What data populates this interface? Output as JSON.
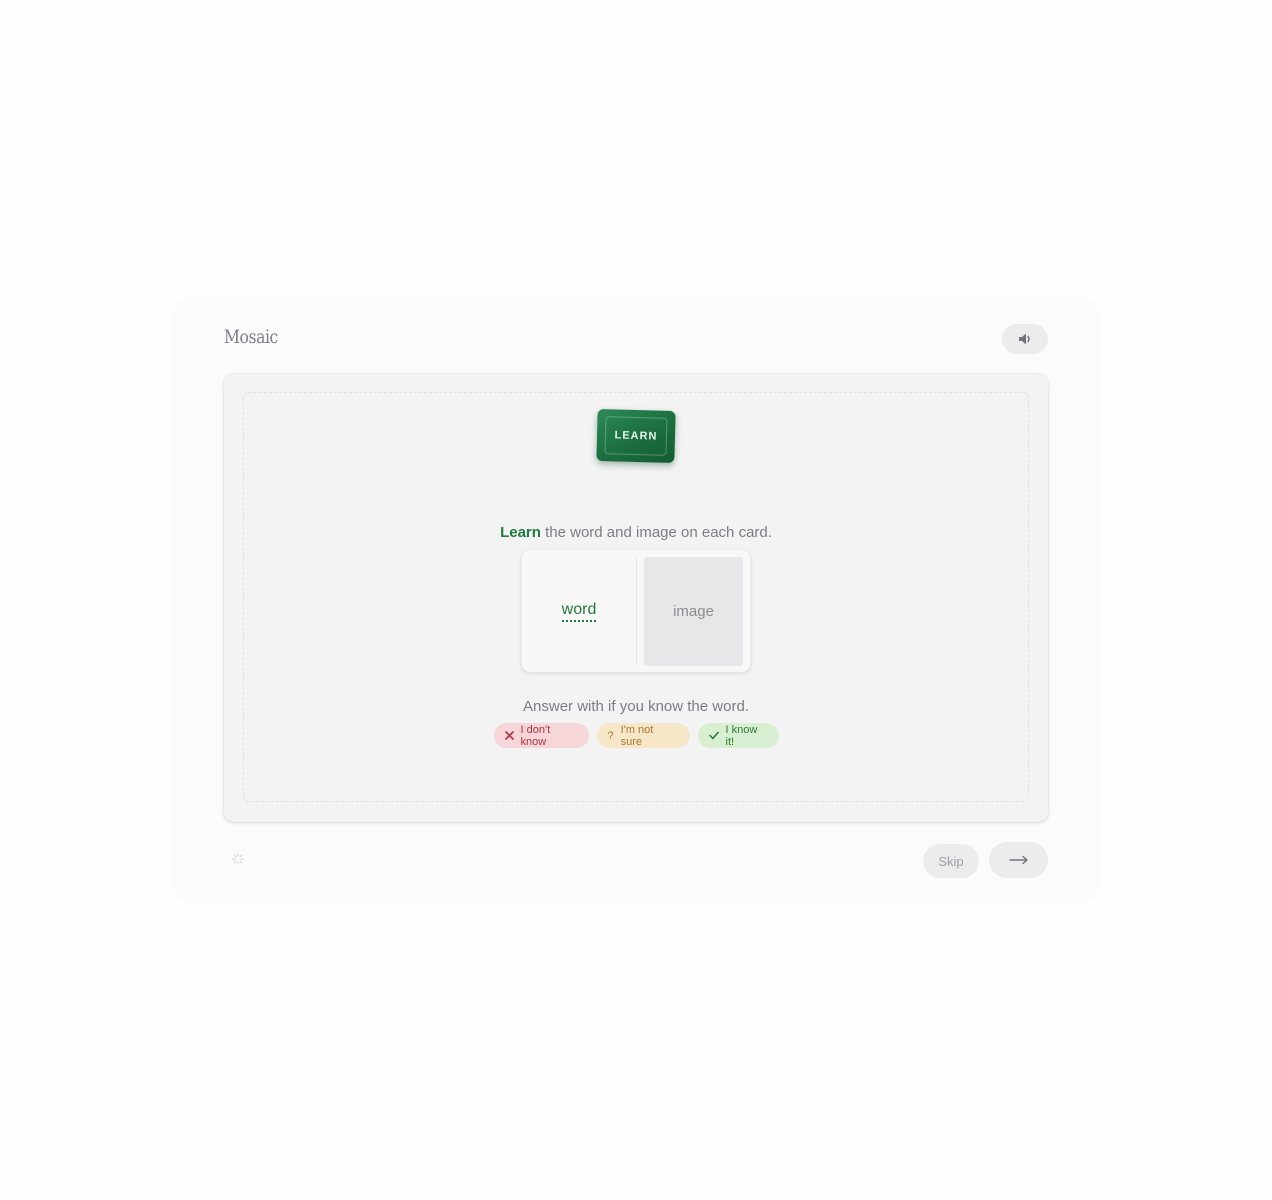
{
  "app": {
    "brand": "Mosaic",
    "sound_icon": "speaker-icon"
  },
  "badge": {
    "label": "LEARN"
  },
  "instruction": {
    "emphasis": "Learn",
    "rest": " the word and image on each card."
  },
  "card": {
    "word": "word",
    "image_placeholder": "image"
  },
  "answer_prompt": "Answer with if you know the word.",
  "answers": [
    {
      "label": "I don't know",
      "icon": "x-icon",
      "color": "#b0333f"
    },
    {
      "label": "I'm not sure",
      "icon": "?",
      "color": "#a8762a"
    },
    {
      "label": "I know it!",
      "icon": "check-icon",
      "color": "#2d7a35"
    }
  ],
  "footer": {
    "skip_label": "Skip",
    "next_icon": "arrow-right-icon",
    "loading_icon": "spinner-icon"
  },
  "colors": {
    "accent_green": "#22793f",
    "badge_green": "#1b6e3f"
  }
}
